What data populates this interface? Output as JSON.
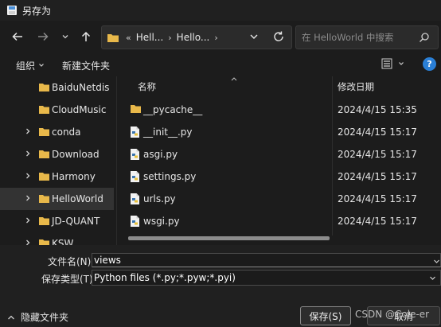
{
  "window": {
    "title": "另存为"
  },
  "address": {
    "crumbs": [
      "Hell...",
      "Hello..."
    ],
    "overflow": "«"
  },
  "search": {
    "placeholder": "在 HelloWorld 中搜索"
  },
  "toolbar": {
    "organize": "组织",
    "new_folder": "新建文件夹"
  },
  "sidebar": {
    "items": [
      {
        "label": "BaiduNetdis",
        "has_chevron": false,
        "selected": false
      },
      {
        "label": "CloudMusic",
        "has_chevron": false,
        "selected": false
      },
      {
        "label": "conda",
        "has_chevron": true,
        "selected": false
      },
      {
        "label": "Download",
        "has_chevron": true,
        "selected": false
      },
      {
        "label": "Harmony",
        "has_chevron": true,
        "selected": false
      },
      {
        "label": "HelloWorld",
        "has_chevron": true,
        "selected": true
      },
      {
        "label": "JD-QUANT",
        "has_chevron": true,
        "selected": false
      },
      {
        "label": "KSW",
        "has_chevron": true,
        "selected": false
      }
    ]
  },
  "columns": {
    "name": "名称",
    "modified": "修改日期"
  },
  "files": [
    {
      "name": "__pycache__",
      "date": "2024/4/15 15:35",
      "icon": "folder-icon"
    },
    {
      "name": "__init__.py",
      "date": "2024/4/15 15:17",
      "icon": "python-file-icon"
    },
    {
      "name": "asgi.py",
      "date": "2024/4/15 15:17",
      "icon": "python-file-icon"
    },
    {
      "name": "settings.py",
      "date": "2024/4/15 15:17",
      "icon": "python-file-icon"
    },
    {
      "name": "urls.py",
      "date": "2024/4/15 15:17",
      "icon": "python-file-icon"
    },
    {
      "name": "wsgi.py",
      "date": "2024/4/15 15:17",
      "icon": "python-file-icon"
    }
  ],
  "form": {
    "filename_label": "文件名(N):",
    "filename_value": "views",
    "filetype_label": "保存类型(T):",
    "filetype_value": "Python files (*.py;*.pyw;*.pyi)"
  },
  "footer": {
    "hide_folders": "隐藏文件夹",
    "save": "保存(S)",
    "cancel": "取消",
    "watermark": "CSDN @Cole-er"
  },
  "colors": {
    "accent": "#2a7fd6",
    "folder": "#e8b84a",
    "background": "#1c1c1c"
  }
}
